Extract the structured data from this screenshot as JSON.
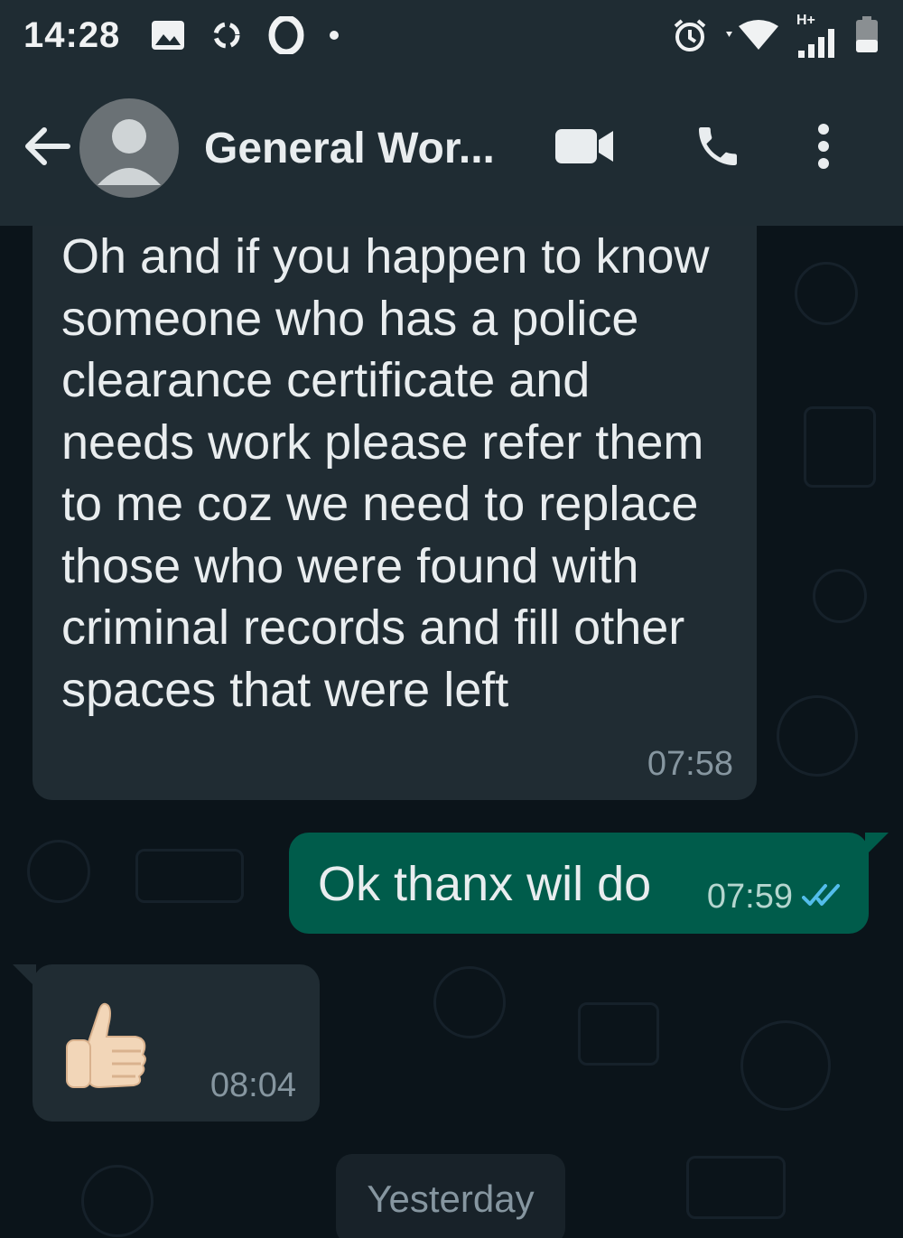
{
  "status_bar": {
    "time": "14:28",
    "network_label": "H+",
    "icons": [
      "image-icon",
      "sync-icon",
      "opera-icon",
      "dot-icon",
      "alarm-icon",
      "wifi-icon",
      "signal-icon",
      "battery-icon"
    ]
  },
  "header": {
    "title": "General Wor...",
    "icons": [
      "back-arrow-icon",
      "avatar",
      "video-call-icon",
      "phone-icon",
      "more-options-icon"
    ]
  },
  "messages": [
    {
      "direction": "incoming",
      "text": "Oh and if you happen to know someone who has a police clearance certificate and needs work please refer them to me coz we need to replace those who were found with criminal records and fill other spaces that were left",
      "time": "07:58"
    },
    {
      "direction": "outgoing",
      "text": "Ok thanx wil do",
      "time": "07:59",
      "status": "read-ticks-icon"
    },
    {
      "direction": "incoming",
      "emoji": "thumbs-up",
      "time": "08:04"
    }
  ],
  "date_separator": "Yesterday",
  "colors": {
    "header_bg": "#1f2c33",
    "chat_bg": "#0b141a",
    "incoming_bubble": "#202c33",
    "outgoing_bubble": "#005c4b",
    "read_tick": "#53bdeb",
    "text": "#e9edef",
    "meta_text": "#8696a0"
  }
}
